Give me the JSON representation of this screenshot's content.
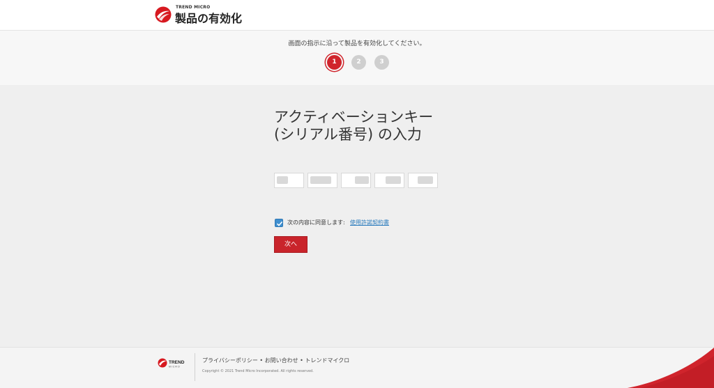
{
  "header": {
    "brand_small": "TREND MICRO",
    "title": "製品の有効化"
  },
  "steps": {
    "instruction": "画面の指示に沿って製品を有効化してください。",
    "items": [
      "1",
      "2",
      "3"
    ],
    "active": "1"
  },
  "main": {
    "heading": "アクティベーションキー (シリアル番号) の入力",
    "key_fields": [
      "",
      "",
      "",
      "",
      ""
    ],
    "agree_checked": true,
    "agree_label": "次の内容に同意します:",
    "eula_link": "使用許諾契約書",
    "next_button": "次へ"
  },
  "footer": {
    "logo_text": "TREND",
    "logo_sub": "MICRO",
    "links": "プライバシーポリシー • お問い合わせ • トレンドマイクロ",
    "copyright": "Copyright © 2021 Trend Micro Incorporated. All rights reserved."
  },
  "colors": {
    "accent_red": "#d0242c",
    "link_blue": "#2a7bbd",
    "checkbox_blue": "#3f8fcf"
  },
  "icons": {
    "brand": "trend-micro-logo-icon",
    "checkbox": "check-icon"
  }
}
